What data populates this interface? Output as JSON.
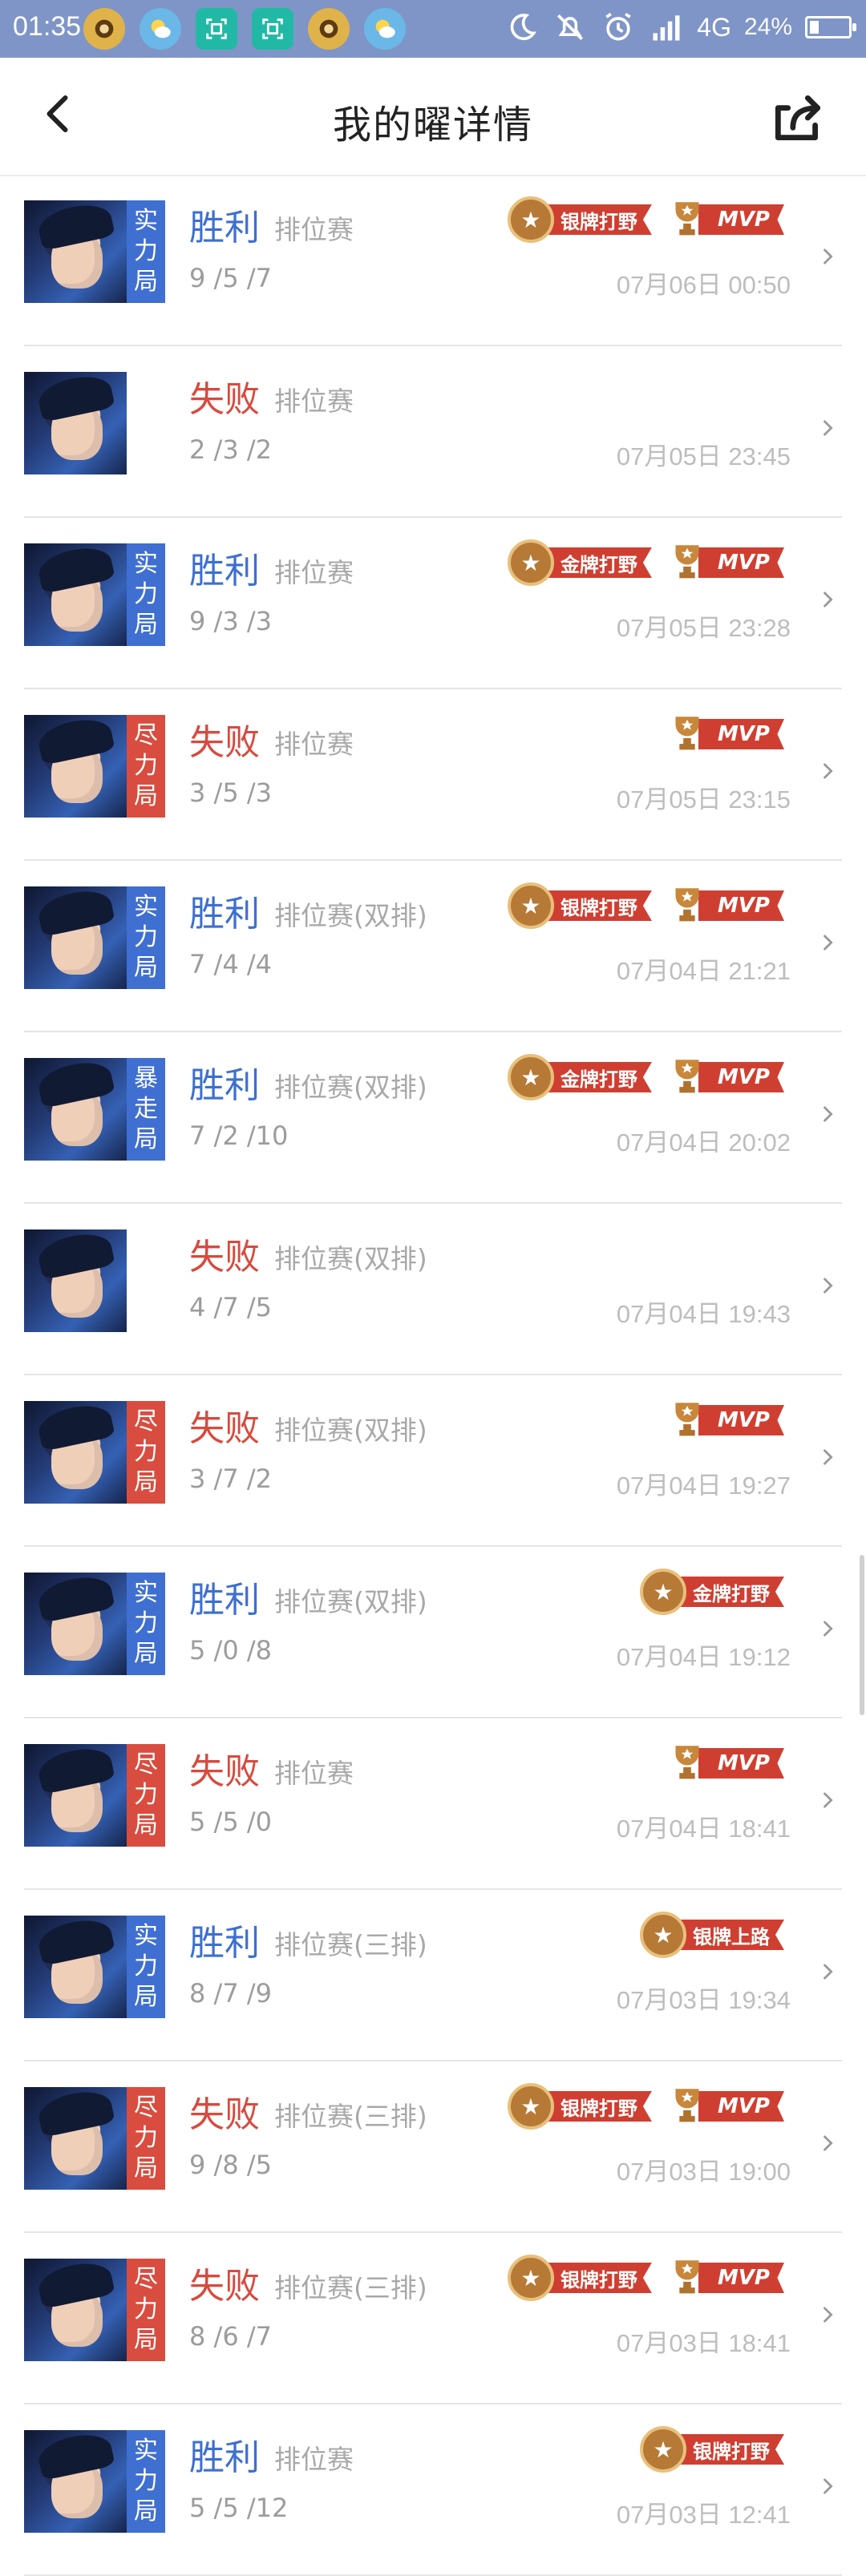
{
  "status": {
    "time": "01:35",
    "network_label": "4G",
    "battery_pct": "24%",
    "battery_level": 0.24,
    "apps": [
      "bird-app-icon",
      "weather-icon",
      "scan-icon",
      "scan-icon",
      "bird-app-icon",
      "weather-icon"
    ]
  },
  "header": {
    "title": "我的曜详情"
  },
  "matches": [
    {
      "result": "胜利",
      "outcome": "win",
      "mode": "排位赛",
      "tag": [
        "实",
        "力",
        "局"
      ],
      "tag_color": "blue",
      "kda": "9 /5 /7",
      "badges": [
        {
          "kind": "silver",
          "label": "银牌打野"
        },
        {
          "kind": "mvp",
          "label": "MVP"
        }
      ],
      "time": "07月06日 00:50"
    },
    {
      "result": "失败",
      "outcome": "loss",
      "mode": "排位赛",
      "tag": [],
      "tag_color": "none",
      "kda": "2 /3 /2",
      "badges": [],
      "time": "07月05日 23:45"
    },
    {
      "result": "胜利",
      "outcome": "win",
      "mode": "排位赛",
      "tag": [
        "实",
        "力",
        "局"
      ],
      "tag_color": "blue",
      "kda": "9 /3 /3",
      "badges": [
        {
          "kind": "gold",
          "label": "金牌打野"
        },
        {
          "kind": "mvp",
          "label": "MVP"
        }
      ],
      "time": "07月05日 23:28"
    },
    {
      "result": "失败",
      "outcome": "loss",
      "mode": "排位赛",
      "tag": [
        "尽",
        "力",
        "局"
      ],
      "tag_color": "red",
      "kda": "3 /5 /3",
      "badges": [
        {
          "kind": "mvp",
          "label": "MVP"
        }
      ],
      "time": "07月05日 23:15"
    },
    {
      "result": "胜利",
      "outcome": "win",
      "mode": "排位赛(双排)",
      "tag": [
        "实",
        "力",
        "局"
      ],
      "tag_color": "blue",
      "kda": "7 /4 /4",
      "badges": [
        {
          "kind": "silver",
          "label": "银牌打野"
        },
        {
          "kind": "mvp",
          "label": "MVP"
        }
      ],
      "time": "07月04日 21:21"
    },
    {
      "result": "胜利",
      "outcome": "win",
      "mode": "排位赛(双排)",
      "tag": [
        "暴",
        "走",
        "局"
      ],
      "tag_color": "blue",
      "kda": "7 /2 /10",
      "badges": [
        {
          "kind": "gold",
          "label": "金牌打野"
        },
        {
          "kind": "mvp",
          "label": "MVP"
        }
      ],
      "time": "07月04日 20:02"
    },
    {
      "result": "失败",
      "outcome": "loss",
      "mode": "排位赛(双排)",
      "tag": [],
      "tag_color": "none",
      "kda": "4 /7 /5",
      "badges": [],
      "time": "07月04日 19:43"
    },
    {
      "result": "失败",
      "outcome": "loss",
      "mode": "排位赛(双排)",
      "tag": [
        "尽",
        "力",
        "局"
      ],
      "tag_color": "red",
      "kda": "3 /7 /2",
      "badges": [
        {
          "kind": "mvp",
          "label": "MVP"
        }
      ],
      "time": "07月04日 19:27"
    },
    {
      "result": "胜利",
      "outcome": "win",
      "mode": "排位赛(双排)",
      "tag": [
        "实",
        "力",
        "局"
      ],
      "tag_color": "blue",
      "kda": "5 /0 /8",
      "badges": [
        {
          "kind": "gold",
          "label": "金牌打野"
        }
      ],
      "time": "07月04日 19:12"
    },
    {
      "result": "失败",
      "outcome": "loss",
      "mode": "排位赛",
      "tag": [
        "尽",
        "力",
        "局"
      ],
      "tag_color": "red",
      "kda": "5 /5 /0",
      "badges": [
        {
          "kind": "mvp",
          "label": "MVP"
        }
      ],
      "time": "07月04日 18:41"
    },
    {
      "result": "胜利",
      "outcome": "win",
      "mode": "排位赛(三排)",
      "tag": [
        "实",
        "力",
        "局"
      ],
      "tag_color": "blue",
      "kda": "8 /7 /9",
      "badges": [
        {
          "kind": "silver",
          "label": "银牌上路"
        }
      ],
      "time": "07月03日 19:34"
    },
    {
      "result": "失败",
      "outcome": "loss",
      "mode": "排位赛(三排)",
      "tag": [
        "尽",
        "力",
        "局"
      ],
      "tag_color": "red",
      "kda": "9 /8 /5",
      "badges": [
        {
          "kind": "silver",
          "label": "银牌打野"
        },
        {
          "kind": "mvp",
          "label": "MVP"
        }
      ],
      "time": "07月03日 19:00"
    },
    {
      "result": "失败",
      "outcome": "loss",
      "mode": "排位赛(三排)",
      "tag": [
        "尽",
        "力",
        "局"
      ],
      "tag_color": "red",
      "kda": "8 /6 /7",
      "badges": [
        {
          "kind": "silver",
          "label": "银牌打野"
        },
        {
          "kind": "mvp",
          "label": "MVP"
        }
      ],
      "time": "07月03日 18:41"
    },
    {
      "result": "胜利",
      "outcome": "win",
      "mode": "排位赛",
      "tag": [
        "实",
        "力",
        "局"
      ],
      "tag_color": "blue",
      "kda": "5 /5 /12",
      "badges": [
        {
          "kind": "silver",
          "label": "银牌打野"
        }
      ],
      "time": "07月03日 12:41"
    }
  ],
  "colors": {
    "statusbar": "#7f95c7",
    "win": "#3d6fd0",
    "loss": "#d74a3e",
    "tag_blue": "#3f6fd1",
    "tag_red": "#d84d3f"
  }
}
